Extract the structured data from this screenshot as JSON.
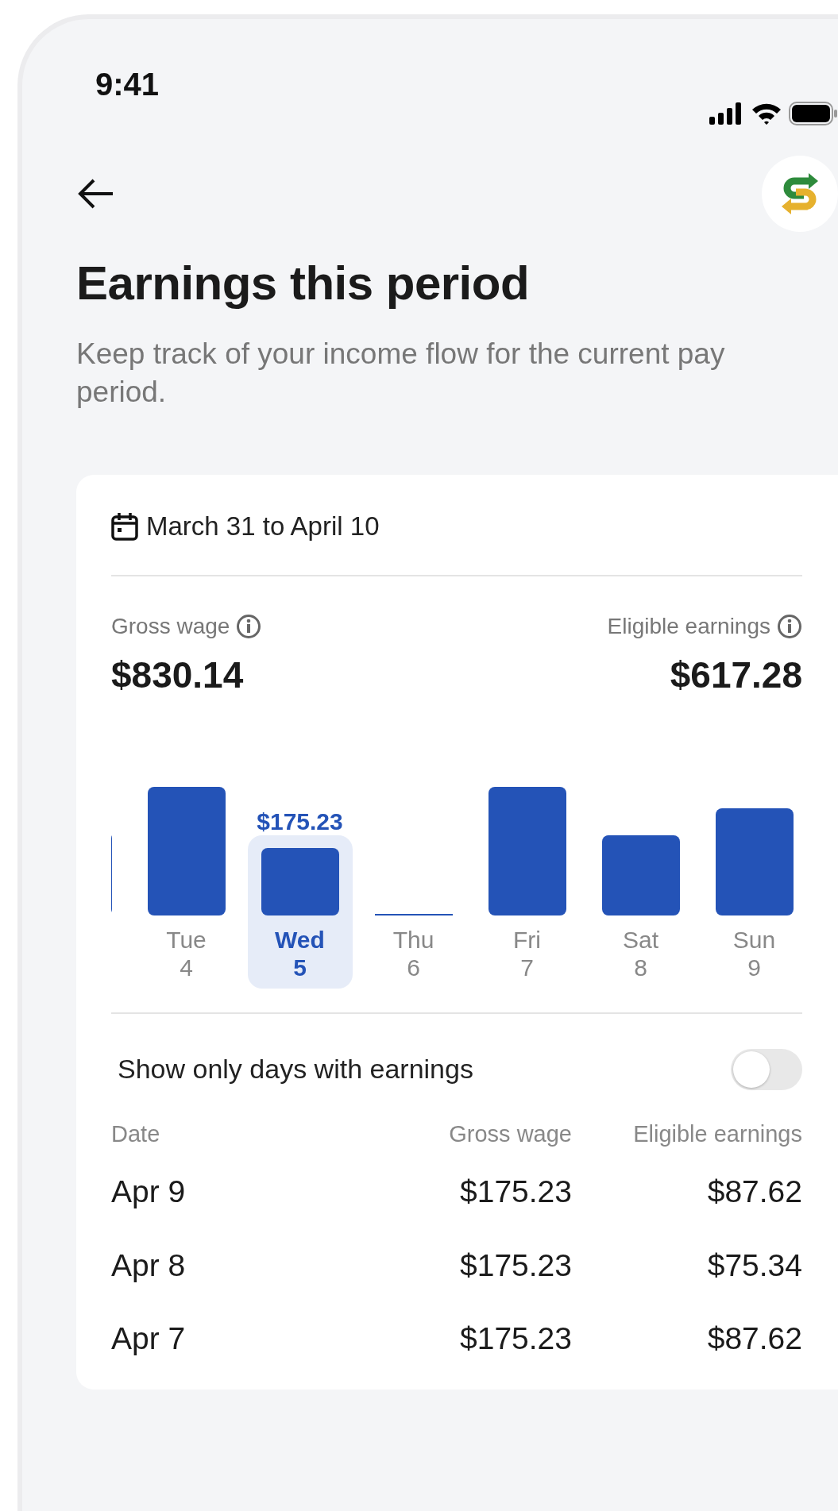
{
  "status_bar": {
    "time": "9:41"
  },
  "header": {
    "title": "Earnings this period",
    "subtitle": "Keep track of your income flow for the current pay period."
  },
  "period": {
    "range": "March 31 to April 10"
  },
  "summary": [
    {
      "label": "Gross wage",
      "amount": "$830.14"
    },
    {
      "label": "Eligible earnings",
      "amount": "$617.28"
    }
  ],
  "days": [
    {
      "day": "Tue",
      "date": "4",
      "selected": false
    },
    {
      "day": "Wed",
      "date": "5",
      "selected": true,
      "value_label": "$175.23"
    },
    {
      "day": "Thu",
      "date": "6",
      "selected": false
    },
    {
      "day": "Fri",
      "date": "7",
      "selected": false
    },
    {
      "day": "Sat",
      "date": "8",
      "selected": false
    },
    {
      "day": "Sun",
      "date": "9",
      "selected": false
    }
  ],
  "toggle": {
    "label": "Show only days with earnings",
    "on": false
  },
  "table": {
    "columns": [
      "Date",
      "Gross wage",
      "Eligible earnings"
    ],
    "rows": [
      [
        "Apr 9",
        "$175.23",
        "$87.62"
      ],
      [
        "Apr 8",
        "$175.23",
        "$75.34"
      ],
      [
        "Apr 7",
        "$175.23",
        "$87.62"
      ]
    ]
  }
}
